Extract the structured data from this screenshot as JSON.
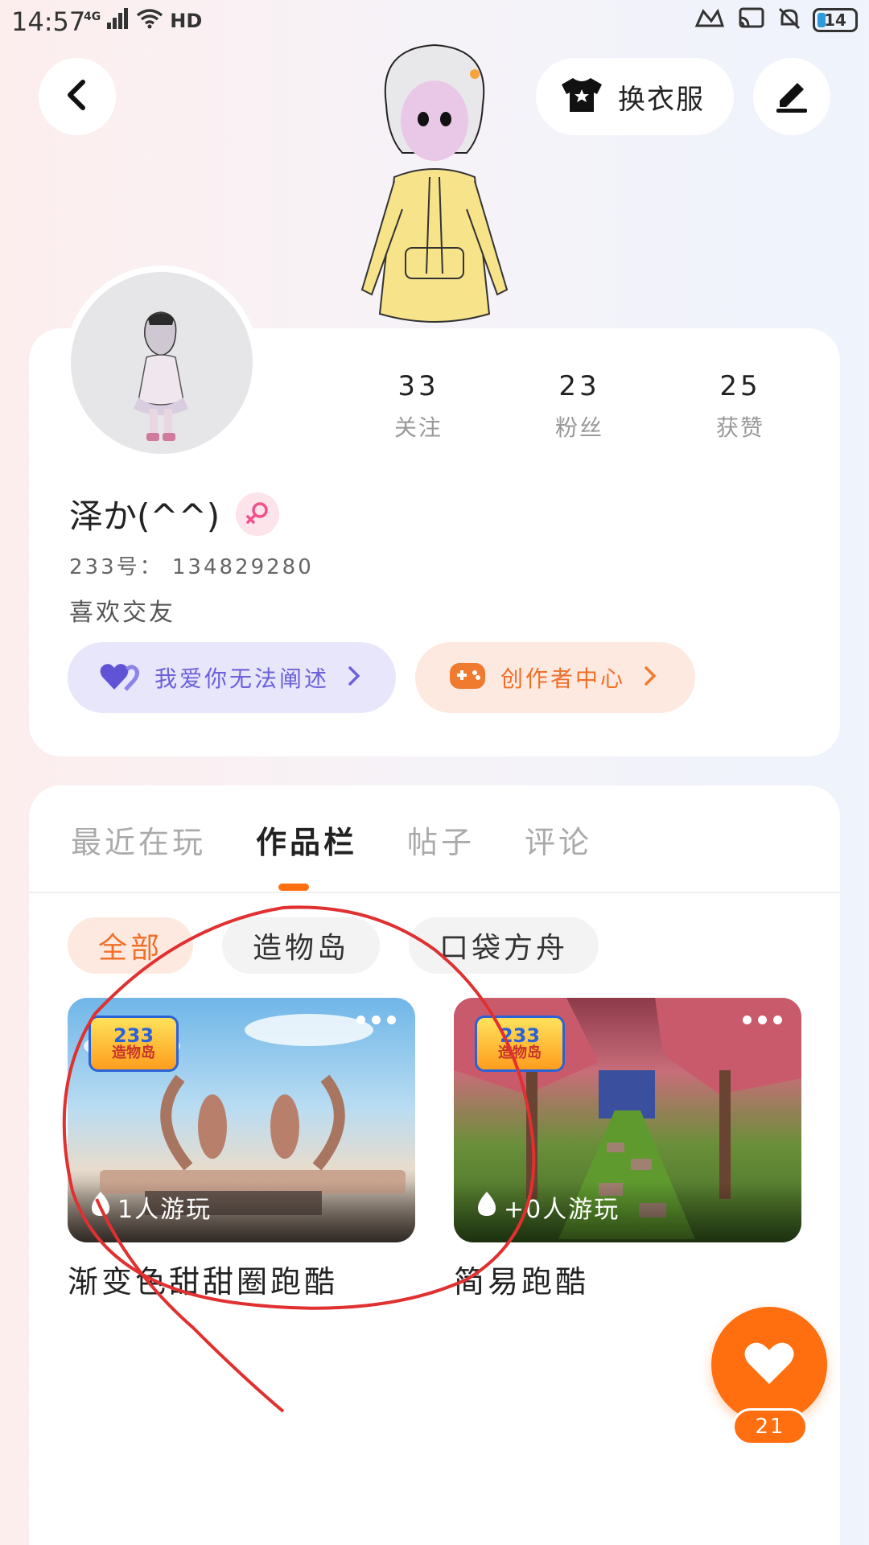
{
  "status_bar": {
    "time": "14:57",
    "network": "4G",
    "hd": "HD",
    "battery_level": "14",
    "icons": [
      "signal-icon",
      "wifi-icon",
      "hd-icon",
      "link-icon",
      "cast-icon",
      "bell-off-icon",
      "battery-icon"
    ]
  },
  "header": {
    "outfit_label": "换衣服"
  },
  "profile": {
    "stats": [
      {
        "value": "33",
        "label": "关注"
      },
      {
        "value": "23",
        "label": "粉丝"
      },
      {
        "value": "25",
        "label": "获赞"
      }
    ],
    "nickname": "泽か(^^)",
    "gender": "female",
    "user_id": "233号： 134829280",
    "bio": "喜欢交友",
    "love_pill_label": "我爱你无法阐述",
    "creator_pill_label": "创作者中心"
  },
  "tabs": [
    {
      "label": "最近在玩",
      "active": false
    },
    {
      "label": "作品栏",
      "active": true
    },
    {
      "label": "帖子",
      "active": false
    },
    {
      "label": "评论",
      "active": false
    }
  ],
  "filters": [
    {
      "label": "全部",
      "active": true
    },
    {
      "label": "造物岛",
      "active": false
    },
    {
      "label": "口袋方舟",
      "active": false
    }
  ],
  "games": [
    {
      "badge_num": "233",
      "badge_name": "造物岛",
      "play_count": "1人游玩",
      "title": "渐变色甜甜圈跑酷"
    },
    {
      "badge_num": "233",
      "badge_name": "造物岛",
      "play_count": "+0人游玩",
      "title": "简易跑酷"
    }
  ],
  "like_button": {
    "count": "21"
  },
  "colors": {
    "accent": "#ff6e0f",
    "love_pill_bg": "#e8e6fb",
    "love_pill_text": "#6c61d9",
    "creator_pill_bg": "#fde9e0",
    "annotation_red": "#e03030"
  }
}
